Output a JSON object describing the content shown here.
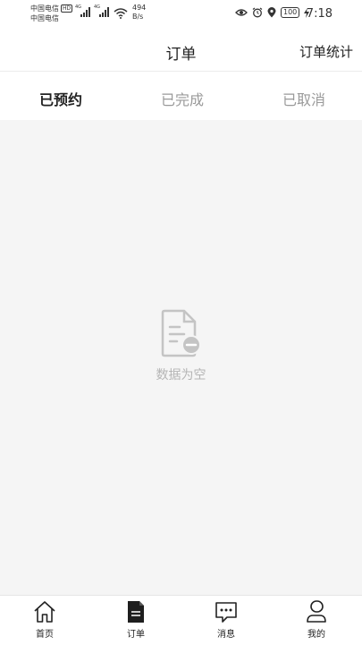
{
  "status_bar": {
    "carrier_1": "中国电信",
    "hd_badge": "HD",
    "carrier_2": "中国电信",
    "net_speed_value": "494",
    "net_speed_unit": "B/s",
    "battery": "100",
    "time": "7:18"
  },
  "header": {
    "title": "订单",
    "stats_label": "订单统计"
  },
  "tabs": [
    {
      "label": "已预约",
      "active": true
    },
    {
      "label": "已完成",
      "active": false
    },
    {
      "label": "已取消",
      "active": false
    }
  ],
  "empty_state": {
    "text": "数据为空",
    "icon": "document-minus-icon"
  },
  "tabbar": {
    "items": [
      {
        "label": "首页",
        "icon": "home-icon"
      },
      {
        "label": "订单",
        "icon": "order-icon",
        "active": true
      },
      {
        "label": "消息",
        "icon": "message-icon"
      },
      {
        "label": "我的",
        "icon": "profile-icon"
      }
    ]
  },
  "colors": {
    "background": "#f5f5f5",
    "text_primary": "#222222",
    "text_inactive": "#9a9a9a",
    "empty_text": "#b5b5b5"
  }
}
